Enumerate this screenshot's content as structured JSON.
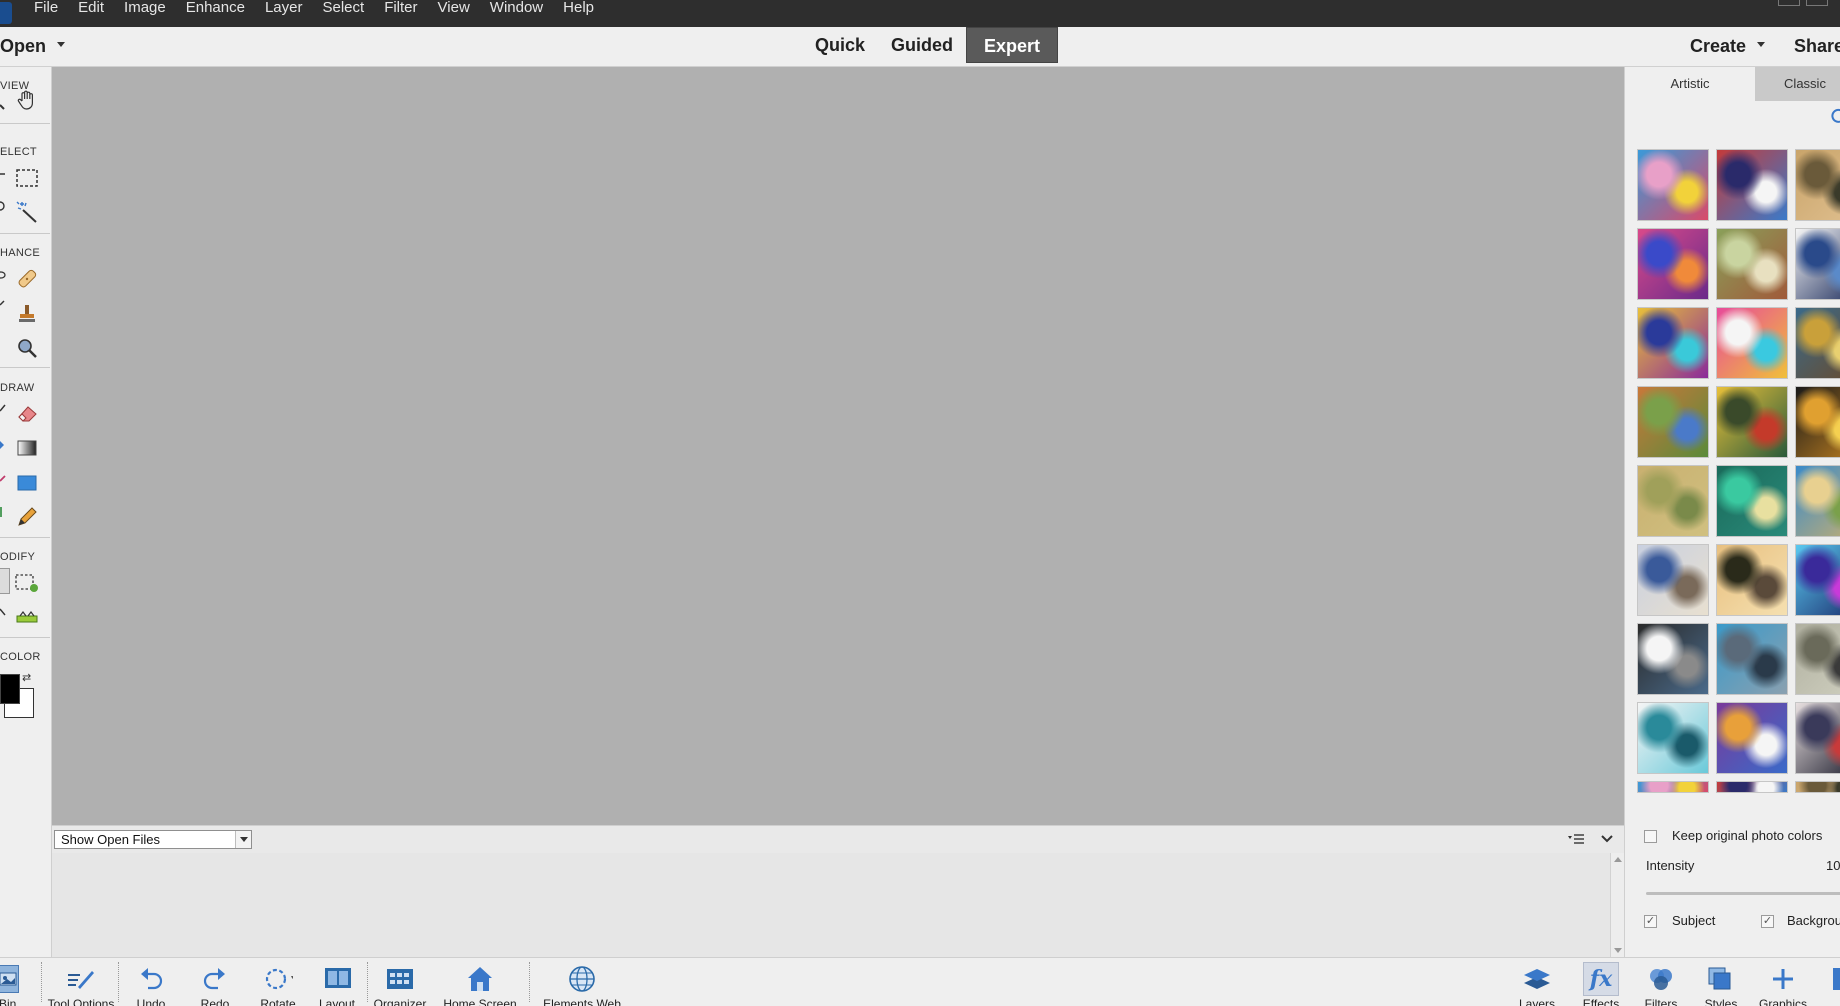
{
  "menubar": {
    "items": [
      "File",
      "Edit",
      "Image",
      "Enhance",
      "Layer",
      "Select",
      "Filter",
      "View",
      "Window",
      "Help"
    ]
  },
  "modebar": {
    "open_label": "Open",
    "modes": [
      "Quick",
      "Guided",
      "Expert"
    ],
    "active_mode": "Expert",
    "create_label": "Create",
    "share_label": "Share"
  },
  "toolbox": {
    "sections": [
      "VIEW",
      "ELECT",
      "HANCE",
      "DRAW",
      "ODIFY",
      "COLOR"
    ]
  },
  "photo_bin": {
    "select_value": "Show Open Files"
  },
  "effects_panel": {
    "tabs": [
      "Artistic",
      "Classic"
    ],
    "active_tab": "Artistic",
    "keep_colors_label": "Keep original photo colors",
    "intensity_label": "Intensity",
    "intensity_value": "10",
    "subject_label": "Subject",
    "background_label": "Backgrou"
  },
  "taskbar": {
    "left": [
      "to Bin",
      "Tool Options",
      "Undo",
      "Redo",
      "Rotate",
      "Layout",
      "Organizer",
      "Home Screen",
      "Elements Web"
    ],
    "right": [
      "Layers",
      "Effects",
      "Filters",
      "Styles",
      "Graphics"
    ]
  },
  "colors": {
    "menubar_bg": "#2e2e2e",
    "canvas_bg": "#b0b0b0",
    "accent_blue": "#3a78c9",
    "active_mode_bg": "#5a5a5a"
  }
}
